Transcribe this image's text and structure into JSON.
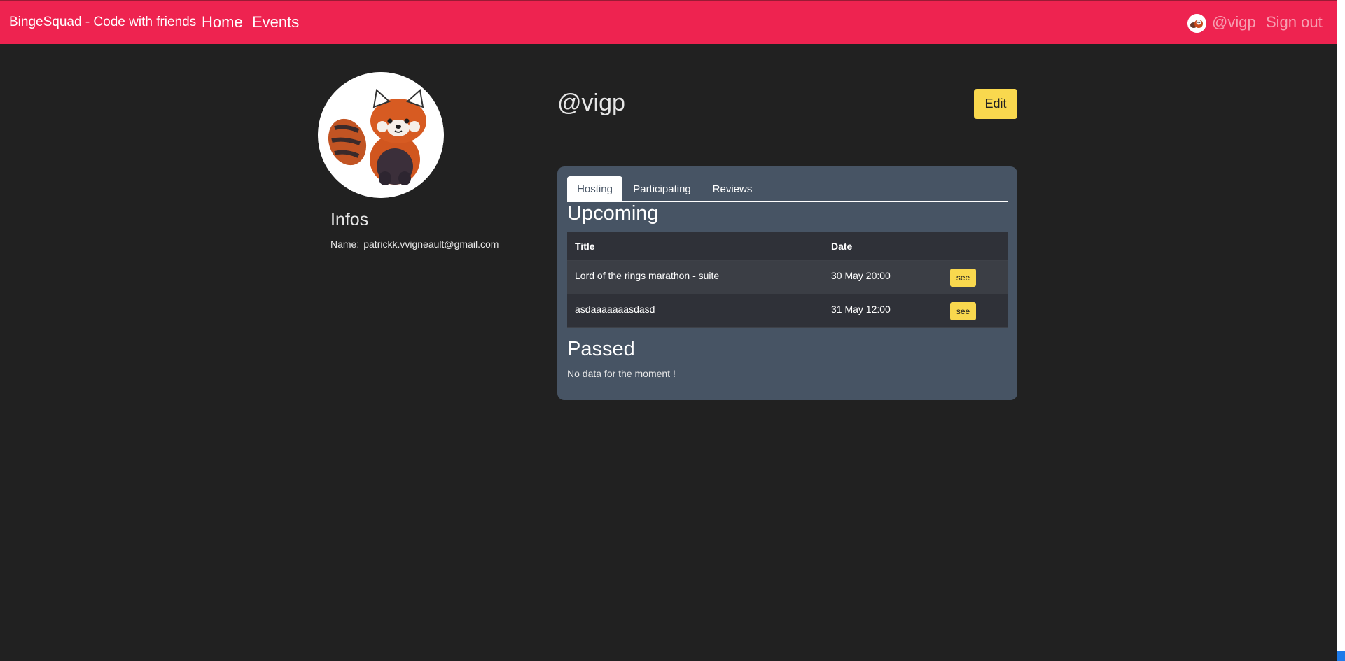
{
  "navbar": {
    "brand": "BingeSquad - Code with friends",
    "links": [
      {
        "label": "Home"
      },
      {
        "label": "Events"
      }
    ],
    "user_handle": "@vigp",
    "signout_label": "Sign out",
    "accent_color": "#ee2350"
  },
  "profile": {
    "username": "@vigp",
    "edit_label": "Edit",
    "infos_title": "Infos",
    "name_label": "Name:",
    "name_value": "patrickk.vvigneault@gmail.com",
    "avatar_icon": "red-panda-avatar"
  },
  "tabs": [
    {
      "label": "Hosting",
      "active": true
    },
    {
      "label": "Participating",
      "active": false
    },
    {
      "label": "Reviews",
      "active": false
    }
  ],
  "upcoming": {
    "title": "Upcoming",
    "headers": {
      "title": "Title",
      "date": "Date"
    },
    "rows": [
      {
        "title": "Lord of the rings marathon - suite",
        "date": "30 May 20:00",
        "action": "see"
      },
      {
        "title": "asdaaaaaaasdasd",
        "date": "31 May 12:00",
        "action": "see"
      }
    ]
  },
  "passed": {
    "title": "Passed",
    "empty_message": "No data for the moment !"
  },
  "colors": {
    "button_yellow": "#f9d84e",
    "card_bg": "#475464",
    "page_bg": "#212121"
  }
}
